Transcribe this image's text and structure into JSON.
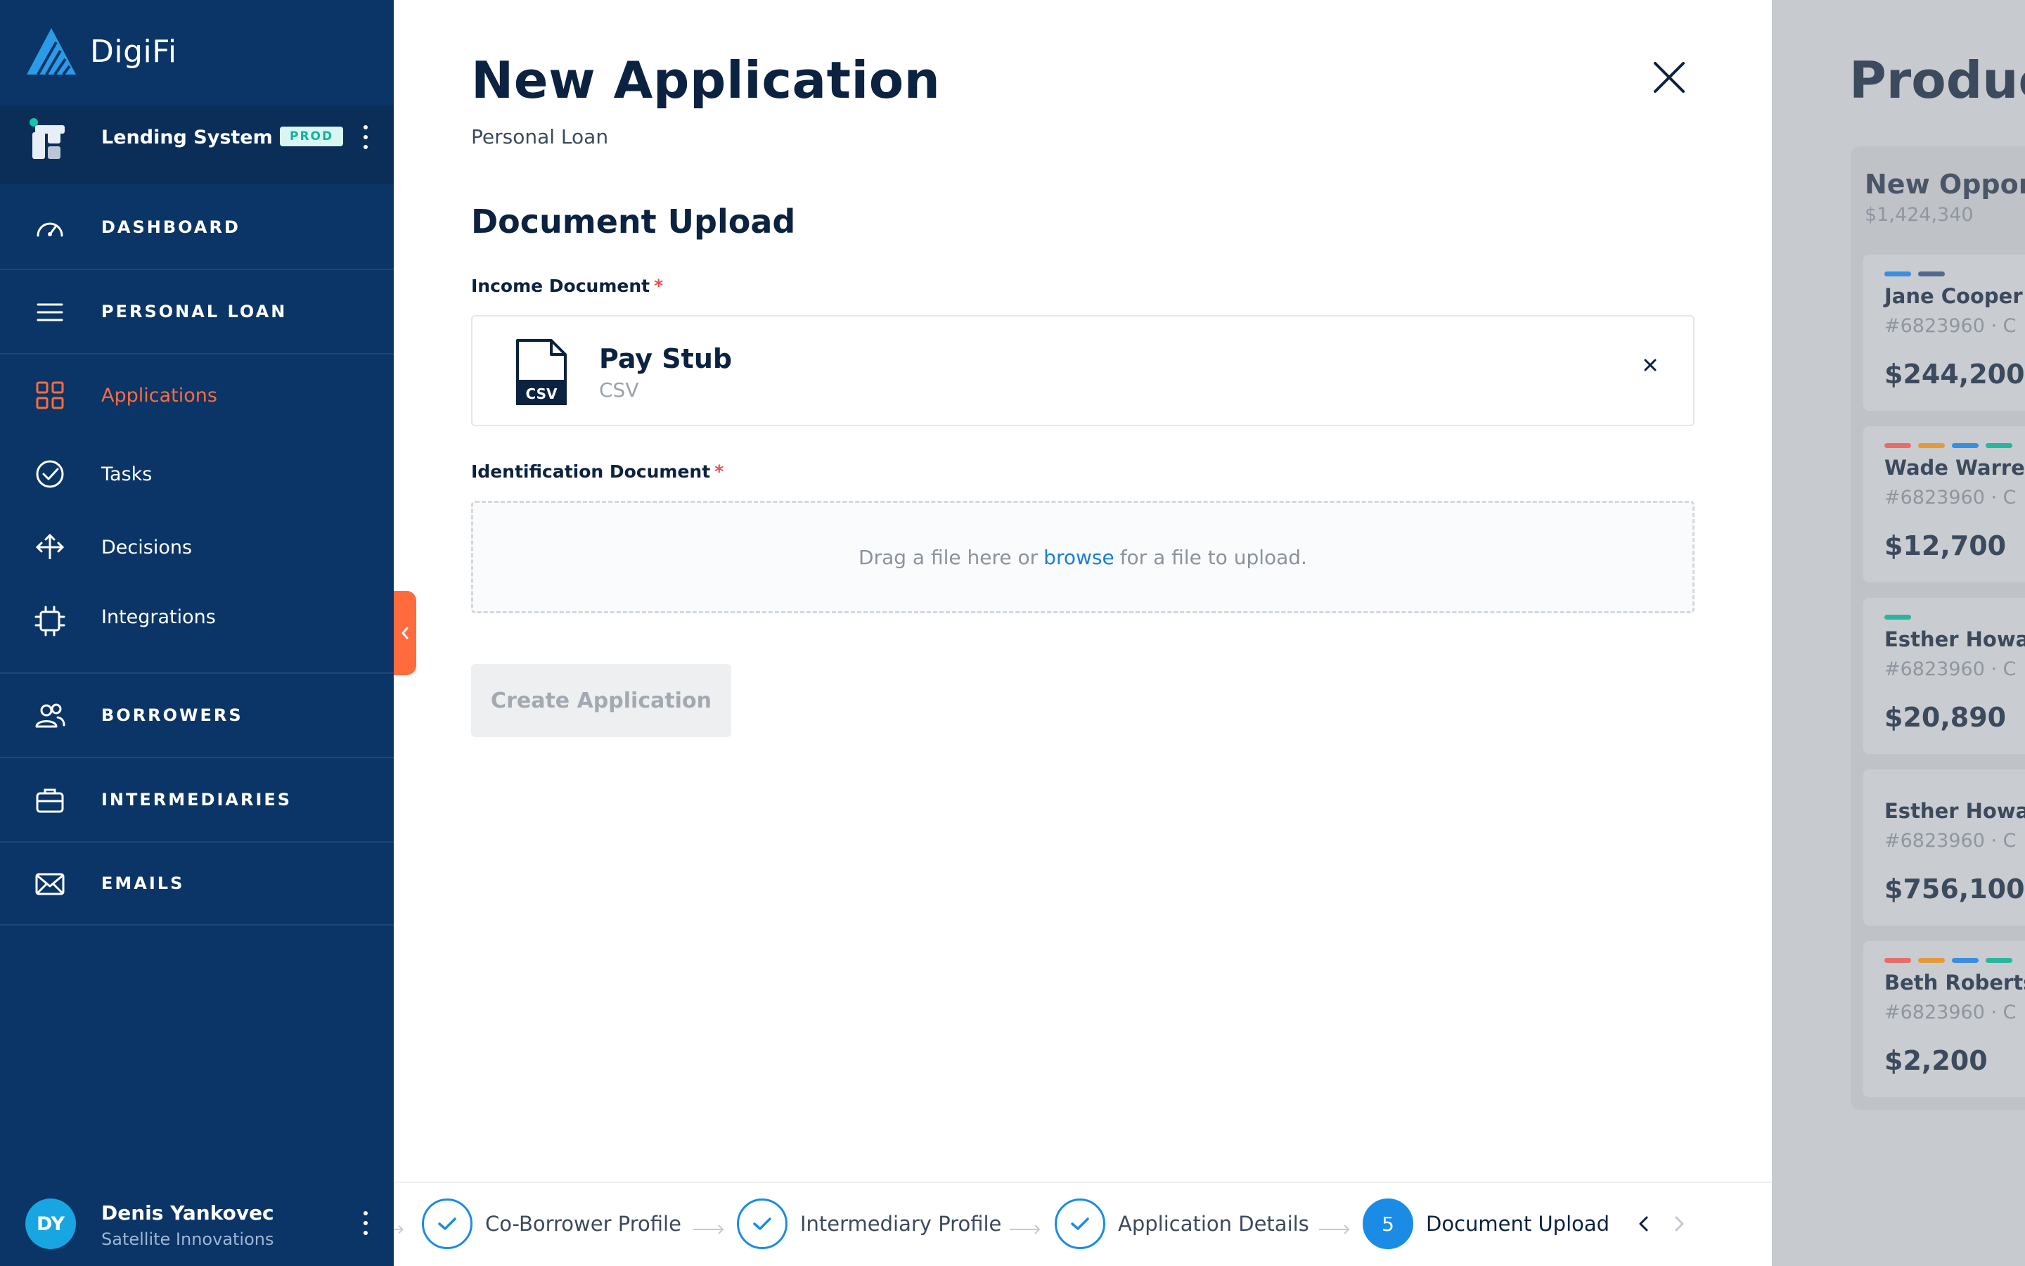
{
  "app": {
    "logo_text": "DigiFi",
    "system_name": "Lending System",
    "environment_badge": "PROD"
  },
  "sidebar": {
    "items": [
      {
        "label": "DASHBOARD",
        "icon": "speedometer-icon"
      },
      {
        "label": "PERSONAL LOAN",
        "icon": "menu-icon"
      },
      {
        "label": "Applications",
        "icon": "grid-icon"
      },
      {
        "label": "Tasks",
        "icon": "check-circle-icon"
      },
      {
        "label": "Decisions",
        "icon": "split-arrows-icon"
      },
      {
        "label": "Integrations",
        "icon": "chip-icon"
      },
      {
        "label": "BORROWERS",
        "icon": "users-icon"
      },
      {
        "label": "INTERMEDIARIES",
        "icon": "briefcase-icon"
      },
      {
        "label": "EMAILS",
        "icon": "envelope-icon"
      }
    ],
    "active_index": 2
  },
  "user": {
    "initials": "DY",
    "name": "Denis Yankovec",
    "organization": "Satellite Innovations"
  },
  "modal": {
    "title": "New Application",
    "subtitle": "Personal Loan",
    "section_title": "Document Upload",
    "income_label": "Income Document",
    "income_file": {
      "name": "Pay Stub",
      "type": "CSV",
      "icon_label": "CSV"
    },
    "identification_label": "Identification Document",
    "required_mark": "*",
    "dropzone": {
      "before": "Drag a file here or",
      "link": "browse",
      "after": "for a file to upload."
    },
    "create_button": "Create Application"
  },
  "stepper": {
    "steps": [
      {
        "label": "Co-Borrower Profile",
        "state": "done"
      },
      {
        "label": "Intermediary Profile",
        "state": "done"
      },
      {
        "label": "Application Details",
        "state": "done"
      },
      {
        "label": "Document Upload",
        "state": "active",
        "number": "5"
      }
    ]
  },
  "board": {
    "title": "Products",
    "column_title": "New Opportunities",
    "column_total": "$1,424,340",
    "cards": [
      {
        "name": "Jane Cooper",
        "id": "#6823960 · C",
        "amount": "$244,200",
        "tags": [
          "#3b8de0",
          "#4f6a8e"
        ]
      },
      {
        "name": "Wade Warren",
        "id": "#6823960 · C",
        "amount": "$12,700",
        "tags": [
          "#e86c6c",
          "#e39a3a",
          "#3b8de0",
          "#2bb5a0"
        ]
      },
      {
        "name": "Esther Howard",
        "id": "#6823960 · C",
        "amount": "$20,890",
        "tags": [
          "#2bb5a0"
        ]
      },
      {
        "name": "Esther Howard",
        "id": "#6823960 · C",
        "amount": "$756,100",
        "tags": []
      },
      {
        "name": "Beth Robertson",
        "id": "#6823960 · C",
        "amount": "$2,200",
        "tags": [
          "#e86c6c",
          "#e39a3a",
          "#3b8de0",
          "#2bb5a0"
        ]
      }
    ]
  },
  "colors": {
    "sidebar_bg": "#0b3566",
    "accent_orange": "#ff6b3d",
    "primary_blue": "#1a8ce6",
    "badge_teal": "#15b39b"
  }
}
